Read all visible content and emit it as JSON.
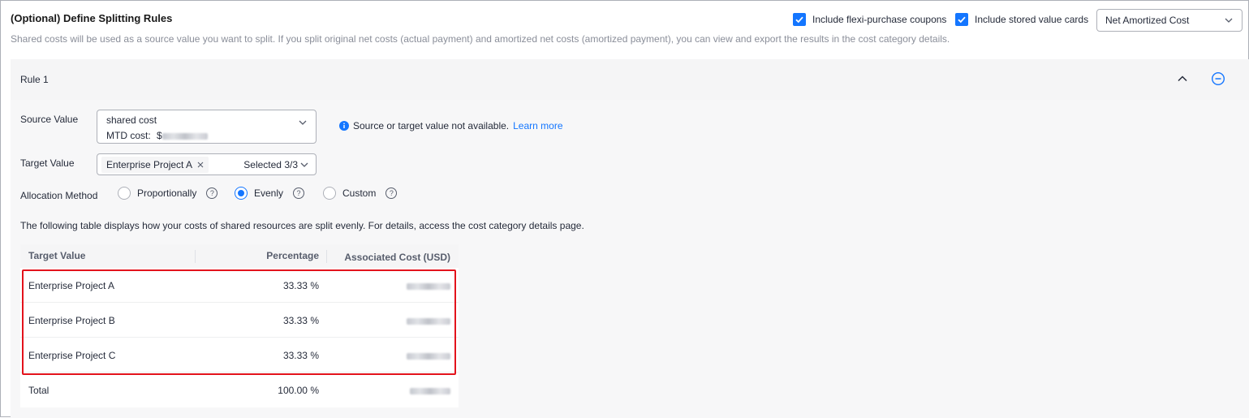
{
  "section": {
    "title": "(Optional) Define Splitting Rules",
    "subtitle": "Shared costs will be used as a source value you want to split. If you split original net costs (actual payment) and amortized net costs (amortized payment), you can view and export the results in the cost category details."
  },
  "options": {
    "flexi_label": "Include flexi-purchase coupons",
    "flexi_checked": true,
    "stored_label": "Include stored value cards",
    "stored_checked": true,
    "cost_type": "Net Amortized Cost"
  },
  "rule": {
    "title": "Rule 1",
    "source_label": "Source Value",
    "source_value": "shared cost",
    "mtd_label": "MTD cost:",
    "mtd_prefix": "$",
    "target_label": "Target Value",
    "target_tag": "Enterprise Project A",
    "target_count": "Selected 3/3",
    "info_text": "Source or target value not available.",
    "learn_more": "Learn more",
    "allocation_label": "Allocation Method",
    "methods": [
      {
        "label": "Proportionally",
        "selected": false
      },
      {
        "label": "Evenly",
        "selected": true
      },
      {
        "label": "Custom",
        "selected": false
      }
    ],
    "table_desc": "The following table displays how your costs of shared resources are split evenly. For details, access the cost category details page."
  },
  "table": {
    "headers": [
      "Target Value",
      "Percentage",
      "Associated Cost (USD)"
    ],
    "rows": [
      {
        "target": "Enterprise Project A",
        "percentage": "33.33 %"
      },
      {
        "target": "Enterprise Project B",
        "percentage": "33.33 %"
      },
      {
        "target": "Enterprise Project C",
        "percentage": "33.33 %"
      }
    ],
    "total": {
      "target": "Total",
      "percentage": "100.00 %"
    }
  },
  "colors": {
    "accent": "#1476ff",
    "highlight": "#e3131c"
  }
}
